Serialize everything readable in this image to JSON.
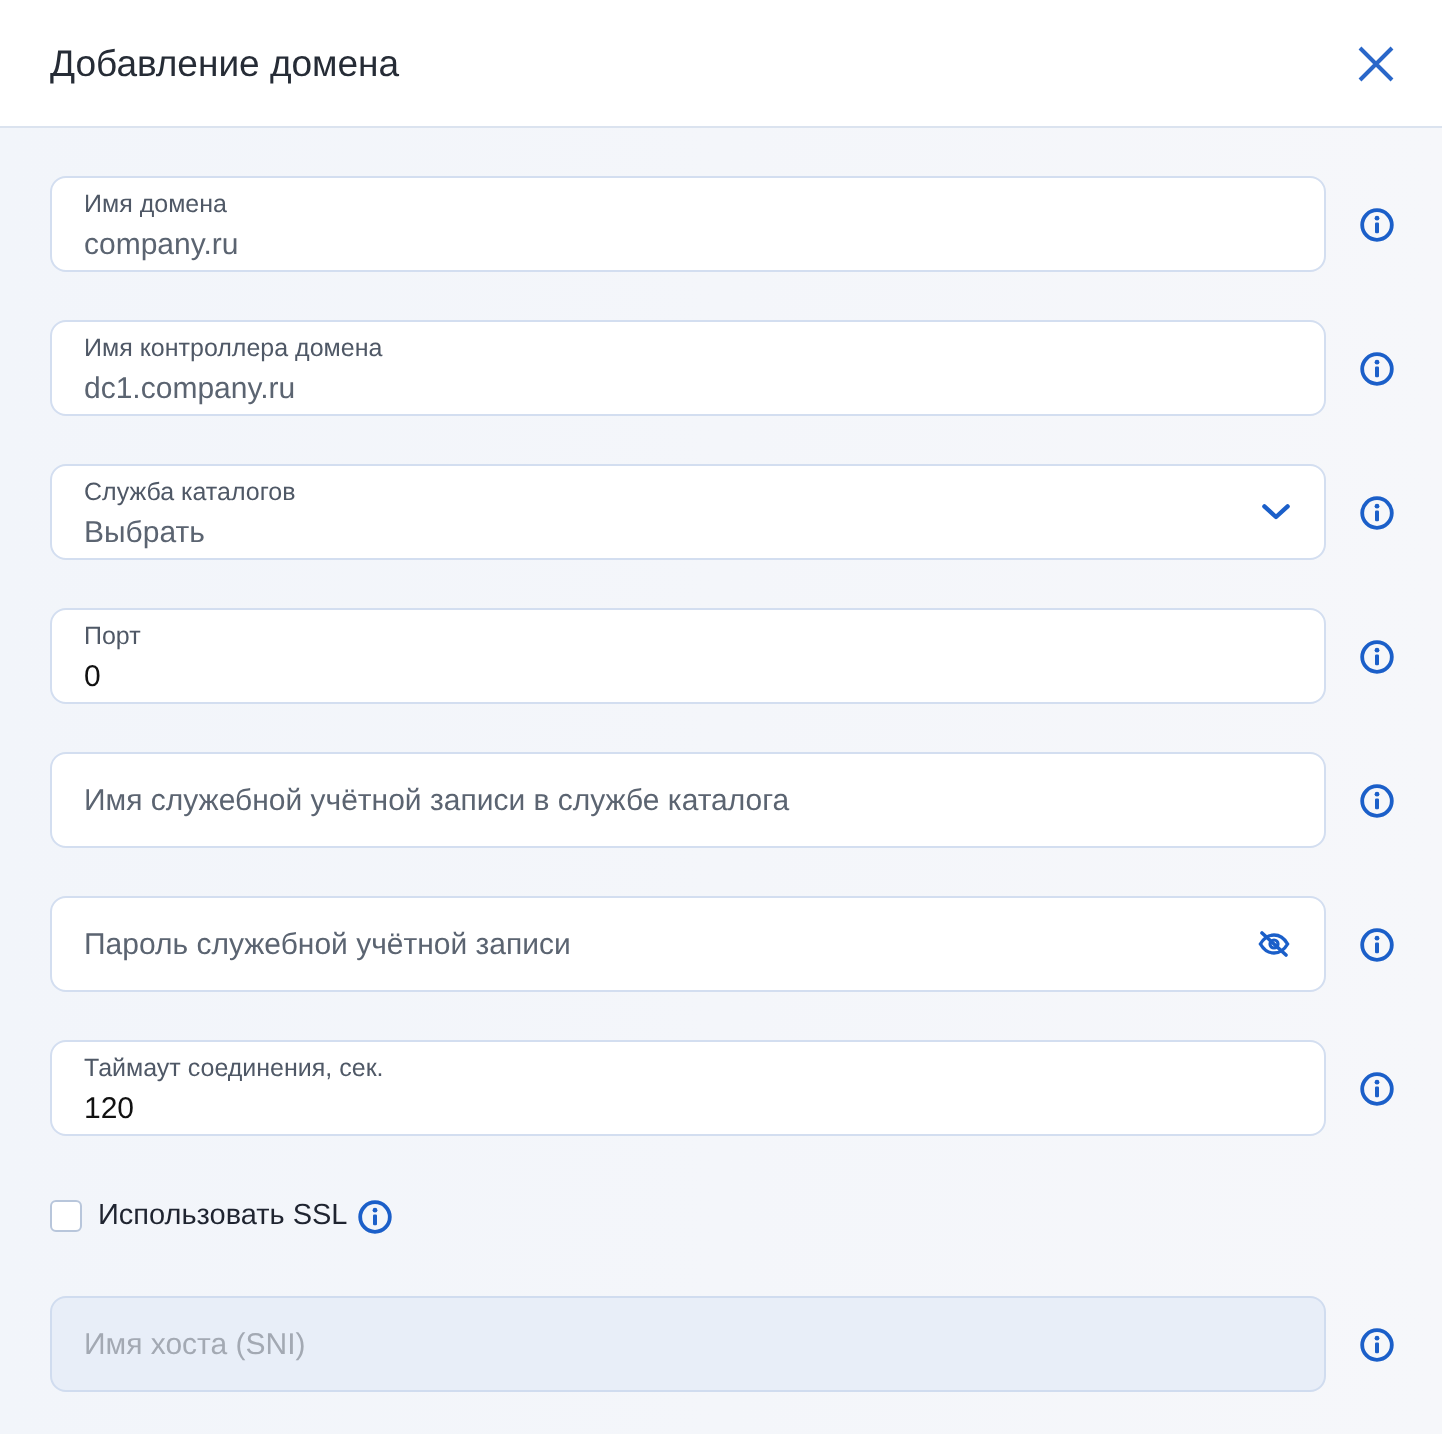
{
  "dialog": {
    "title": "Добавление домена"
  },
  "fields": [
    {
      "kind": "text",
      "label": "Имя домена",
      "placeholder": "company.ru",
      "disabled": false
    },
    {
      "kind": "text",
      "label": "Имя контроллера домена",
      "placeholder": "dc1.company.ru",
      "disabled": false
    },
    {
      "kind": "select",
      "label": "Служба каталогов",
      "placeholder": "Выбрать",
      "disabled": false
    },
    {
      "kind": "text",
      "label": "Порт",
      "value": "0",
      "disabled": false
    },
    {
      "kind": "text",
      "placeholder": "Имя служебной учётной записи в службе каталога",
      "disabled": false
    },
    {
      "kind": "password",
      "placeholder": "Пароль служебной учётной записи",
      "disabled": false
    },
    {
      "kind": "text",
      "label": "Таймаут соединения, сек.",
      "value": "120",
      "disabled": false
    },
    {
      "kind": "checkbox",
      "label": "Использовать SSL",
      "checked": false,
      "disabled": false
    },
    {
      "kind": "text",
      "placeholder": "Имя хоста (SNI)",
      "disabled": true
    }
  ]
}
